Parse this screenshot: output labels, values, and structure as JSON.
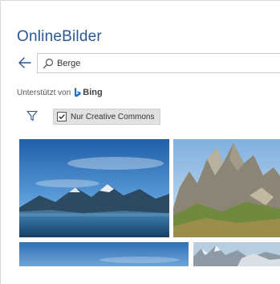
{
  "dialog": {
    "title": "OnlineBilder"
  },
  "search": {
    "back_icon": "back-arrow-icon",
    "search_icon": "search-icon",
    "value": "Berge"
  },
  "powered_by": {
    "label": "Unterstützt von",
    "brand": "Bing",
    "brand_icon": "bing-logo-icon",
    "brand_color": "#1a73c8"
  },
  "filters": {
    "filter_icon": "filter-icon",
    "creative_commons_label": "Nur Creative Commons",
    "creative_commons_checked": true
  },
  "results": [
    {
      "subject": "mountain-lake-sky"
    },
    {
      "subject": "rocky-mountain-peaks"
    },
    {
      "subject": "blue-sky"
    },
    {
      "subject": "mountain-snow"
    }
  ],
  "colors": {
    "title": "#2b5797",
    "toggle_bg": "#e1e1e1"
  }
}
